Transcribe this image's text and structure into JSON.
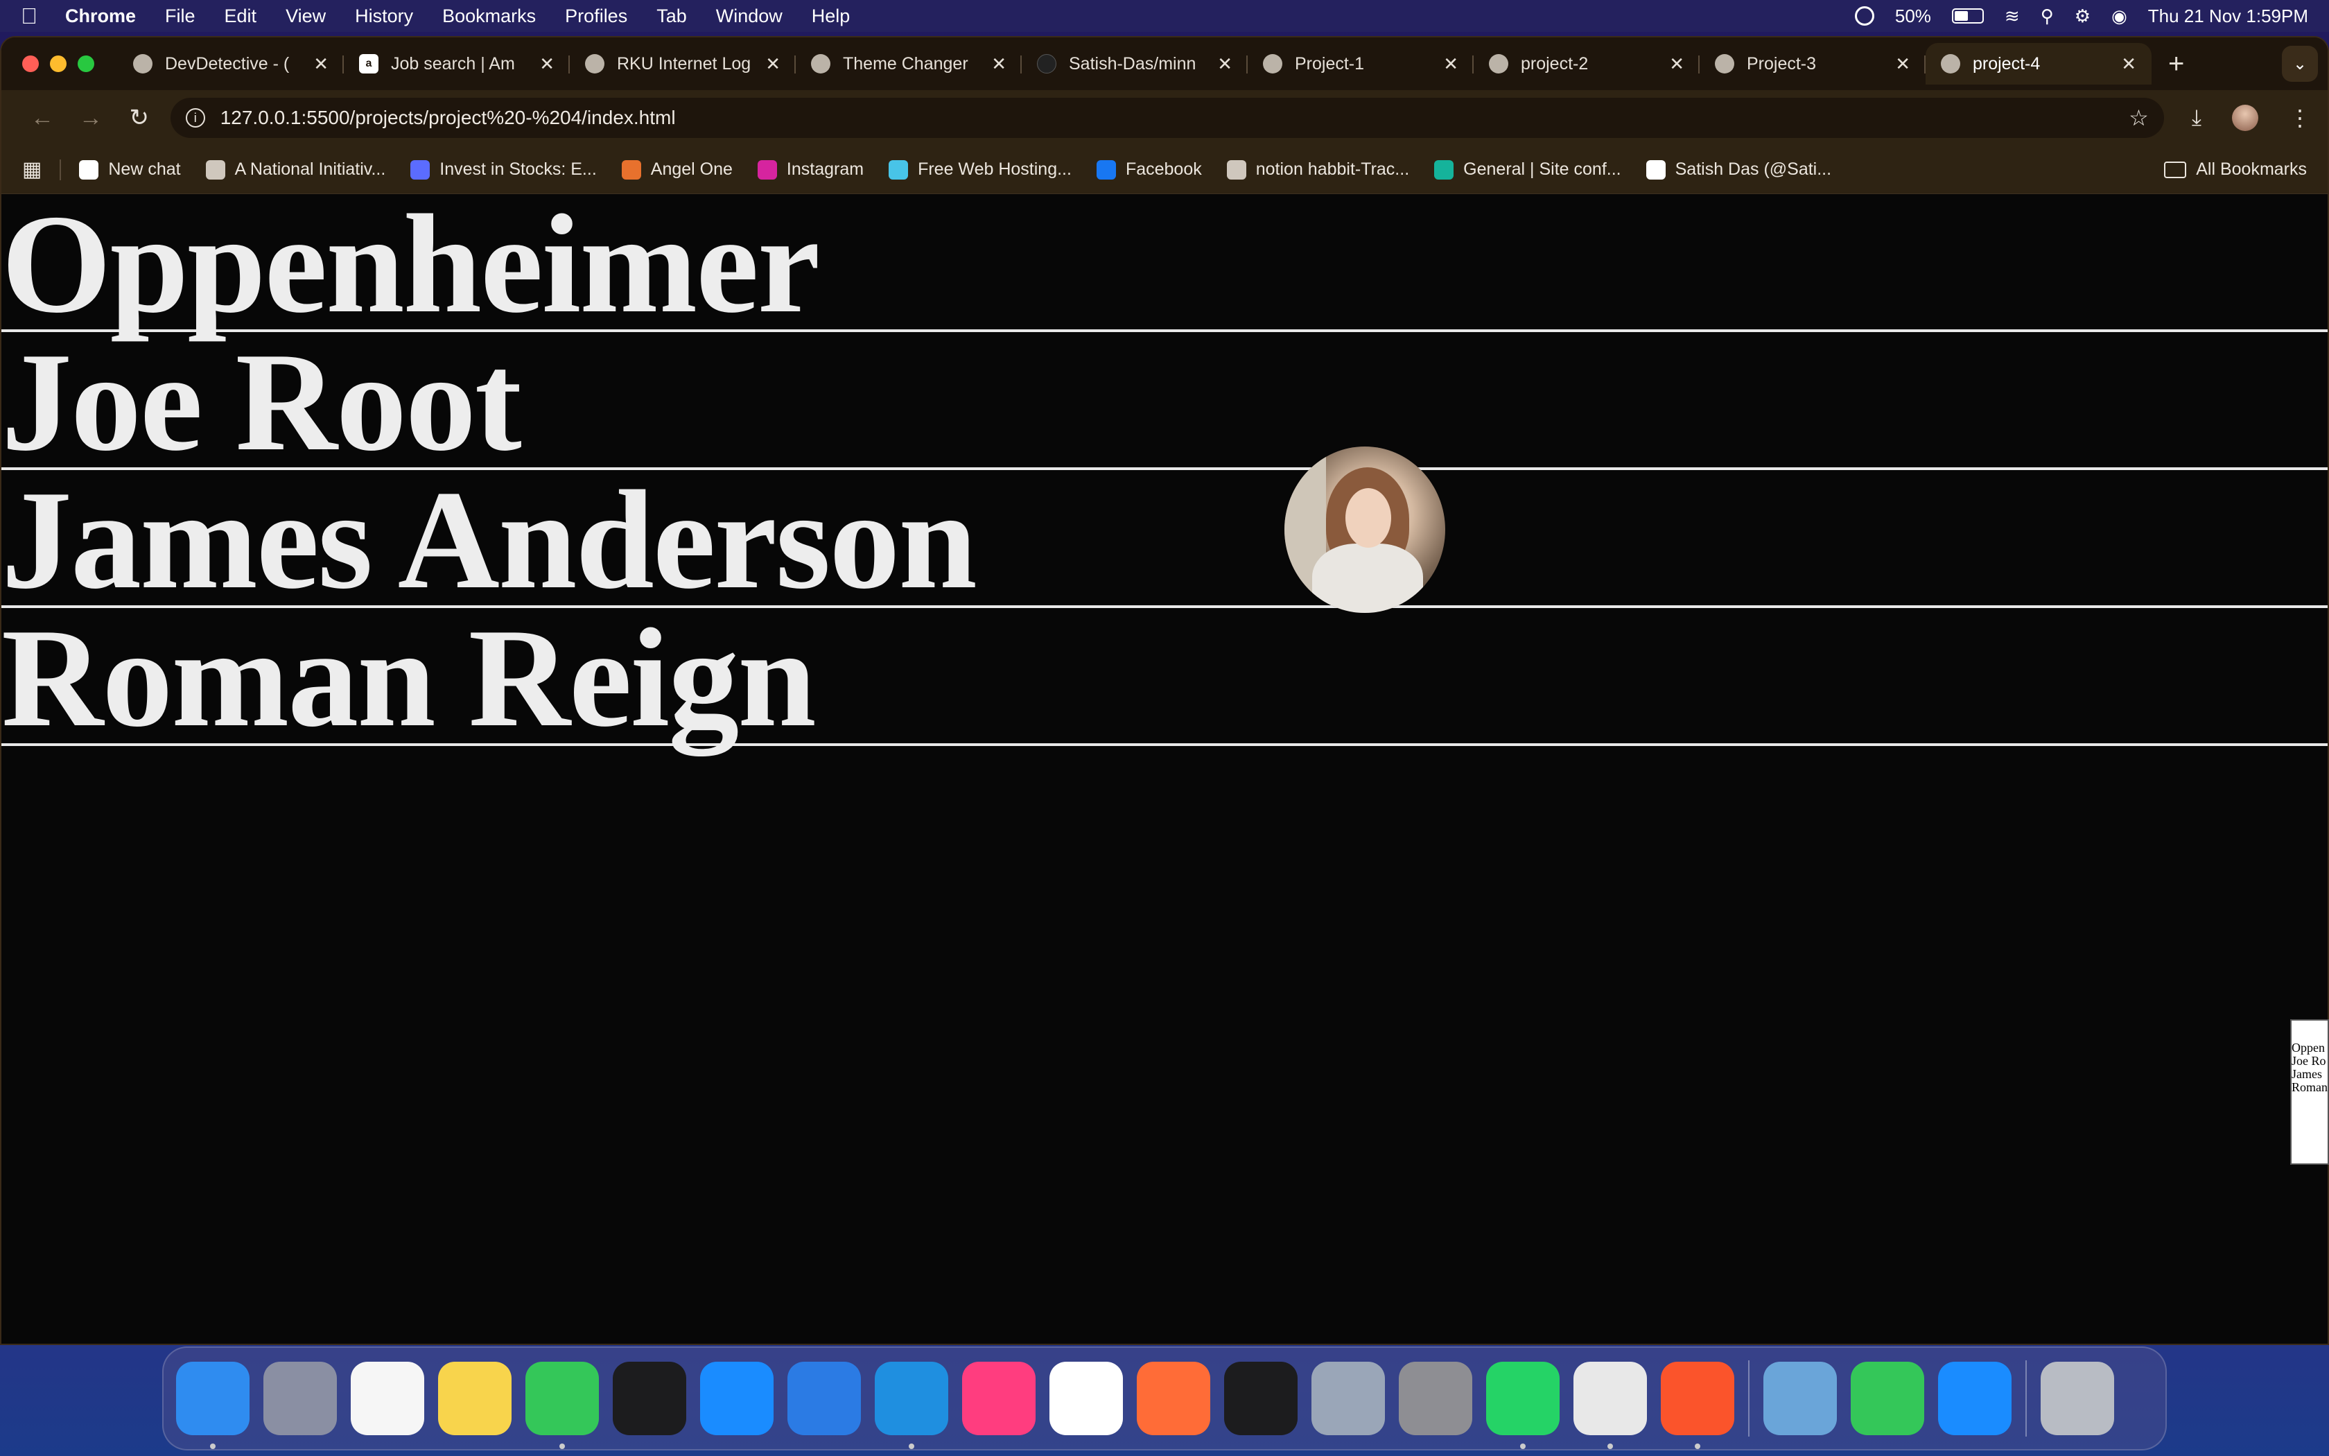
{
  "menubar": {
    "app_name": "Chrome",
    "menus": [
      "File",
      "Edit",
      "View",
      "History",
      "Bookmarks",
      "Profiles",
      "Tab",
      "Window",
      "Help"
    ],
    "battery": "50%",
    "datetime": "Thu 21 Nov  1:59PM",
    "battery_level": 0.5
  },
  "tabs": [
    {
      "title": "DevDetective - (",
      "icon": "globe-icon"
    },
    {
      "title": "Job search | Am",
      "icon": "amazon-icon"
    },
    {
      "title": "RKU Internet Log",
      "icon": "globe-icon"
    },
    {
      "title": "Theme Changer",
      "icon": "globe-icon"
    },
    {
      "title": "Satish-Das/minn",
      "icon": "github-icon"
    },
    {
      "title": "Project-1",
      "icon": "globe-icon"
    },
    {
      "title": "project-2",
      "icon": "globe-icon"
    },
    {
      "title": "Project-3",
      "icon": "globe-icon"
    },
    {
      "title": "project-4",
      "icon": "globe-icon",
      "active": true
    }
  ],
  "address_bar": {
    "url": "127.0.0.1:5500/projects/project%20-%204/index.html"
  },
  "bookmarks": [
    {
      "label": "New chat",
      "icon": "openai-icon",
      "color": "#ffffff"
    },
    {
      "label": "A National Initiativ...",
      "icon": "globe-icon",
      "color": "#cfc7bd"
    },
    {
      "label": "Invest in Stocks: E...",
      "icon": "groww-icon",
      "color": "#5b6cff"
    },
    {
      "label": "Angel One",
      "icon": "angel-one-icon",
      "color": "#e8712d"
    },
    {
      "label": "Instagram",
      "icon": "instagram-icon",
      "color": "#d6249f"
    },
    {
      "label": "Free Web Hosting...",
      "icon": "hosting-icon",
      "color": "#48c4e8"
    },
    {
      "label": "Facebook",
      "icon": "facebook-icon",
      "color": "#1877f2"
    },
    {
      "label": "notion habbit-Trac...",
      "icon": "check-icon",
      "color": "#cfc7bd"
    },
    {
      "label": "General | Site conf...",
      "icon": "netlify-icon",
      "color": "#15b39b"
    },
    {
      "label": "Satish Das (@Sati...",
      "icon": "x-icon",
      "color": "#ffffff"
    }
  ],
  "all_bookmarks_label": "All Bookmarks",
  "page": {
    "rows": [
      "Oppenheimer",
      "Joe Root",
      "James Anderson",
      "Roman Reign"
    ],
    "thumbnail_lines": [
      "Oppen",
      "Joe Ro",
      "James",
      "Roman"
    ]
  },
  "dock": [
    {
      "name": "finder-icon",
      "color": "#2f8cf0",
      "running": true
    },
    {
      "name": "launchpad-icon",
      "color": "#8a8fa3",
      "running": false
    },
    {
      "name": "photos-icon",
      "color": "#f6f6f6",
      "running": false
    },
    {
      "name": "notes-icon",
      "color": "#f8d44c",
      "running": false
    },
    {
      "name": "messages-icon",
      "color": "#34c759",
      "running": true
    },
    {
      "name": "terminal-icon",
      "color": "#1c1c1e",
      "running": false
    },
    {
      "name": "app-store-icon",
      "color": "#1a8cff",
      "running": false
    },
    {
      "name": "xcode-icon",
      "color": "#2b7be4",
      "running": false
    },
    {
      "name": "vscode-icon",
      "color": "#1f8fe0",
      "running": true
    },
    {
      "name": "intellij-icon",
      "color": "#ff3d7f",
      "running": false
    },
    {
      "name": "mongodb-compass-icon",
      "color": "#ffffff",
      "running": false
    },
    {
      "name": "postman-icon",
      "color": "#ff6c37",
      "running": false
    },
    {
      "name": "apple-tv-icon",
      "color": "#1c1c1e",
      "running": false
    },
    {
      "name": "quicktime-icon",
      "color": "#9aa6b8",
      "running": false
    },
    {
      "name": "system-settings-icon",
      "color": "#8e8e93",
      "running": false
    },
    {
      "name": "whatsapp-icon",
      "color": "#25d366",
      "running": true
    },
    {
      "name": "chrome-icon",
      "color": "#e8e8e8",
      "running": true
    },
    {
      "name": "brave-icon",
      "color": "#fb542b",
      "running": true
    },
    {
      "name": "preview-icon",
      "color": "#6aa5d9",
      "running": false
    },
    {
      "name": "facetime-icon",
      "color": "#34c759",
      "running": false
    },
    {
      "name": "xcode-simulator-icon",
      "color": "#1a8cff",
      "running": false
    },
    {
      "name": "trash-icon",
      "color": "#b8bcc4",
      "running": false
    }
  ]
}
